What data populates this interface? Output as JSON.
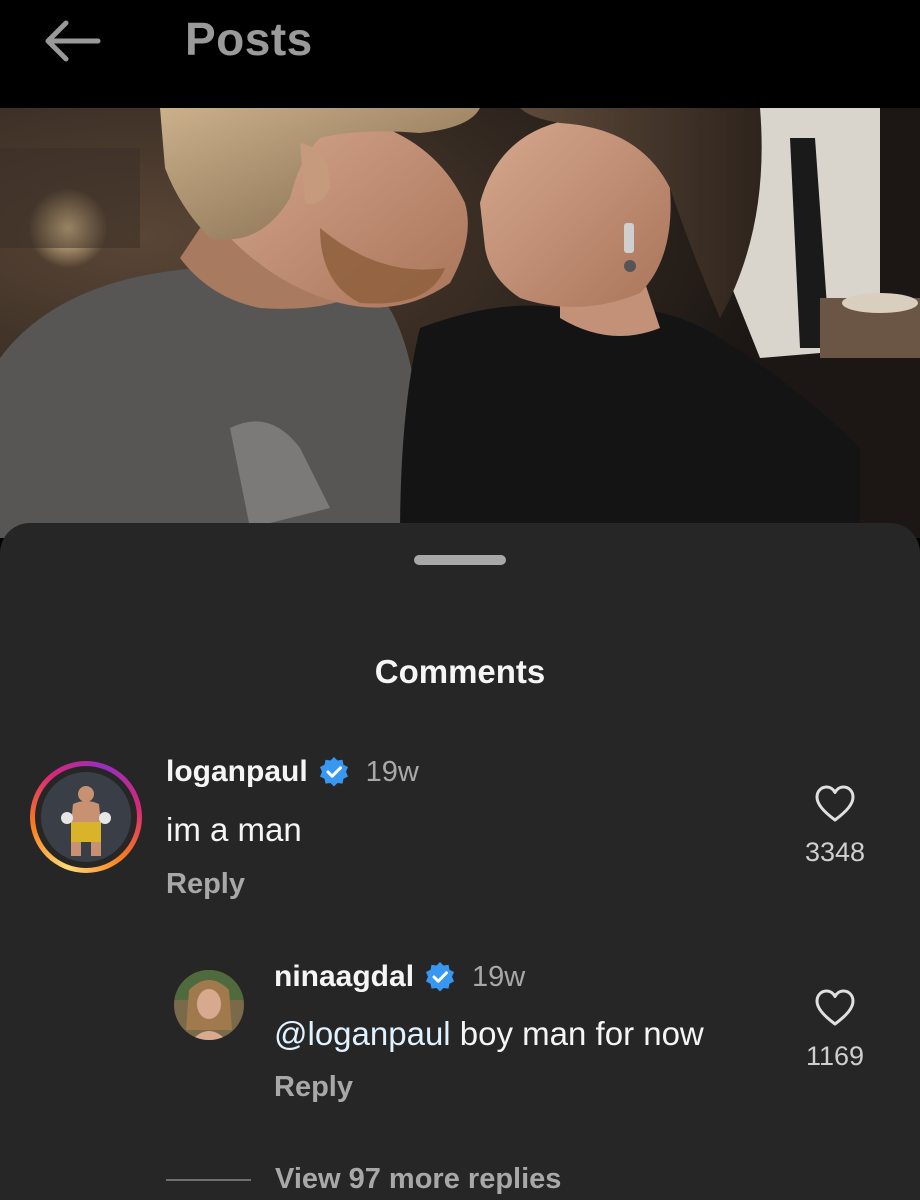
{
  "header": {
    "title": "Posts",
    "back_icon": "arrow-left-icon"
  },
  "comments_sheet": {
    "title": "Comments"
  },
  "comments": [
    {
      "username": "loganpaul",
      "verified": true,
      "time": "19w",
      "text": "im a man",
      "reply_label": "Reply",
      "likes": "3348",
      "has_story_ring": true
    }
  ],
  "replies": [
    {
      "username": "ninaagdal",
      "verified": true,
      "time": "19w",
      "mention": "@loganpaul",
      "text": " boy man for now",
      "reply_label": "Reply",
      "likes": "1169"
    }
  ],
  "view_more_replies": "View 97 more replies",
  "colors": {
    "background": "#000000",
    "sheet": "#262626",
    "verified": "#3897f0",
    "secondary_text": "#a8a8a8"
  }
}
